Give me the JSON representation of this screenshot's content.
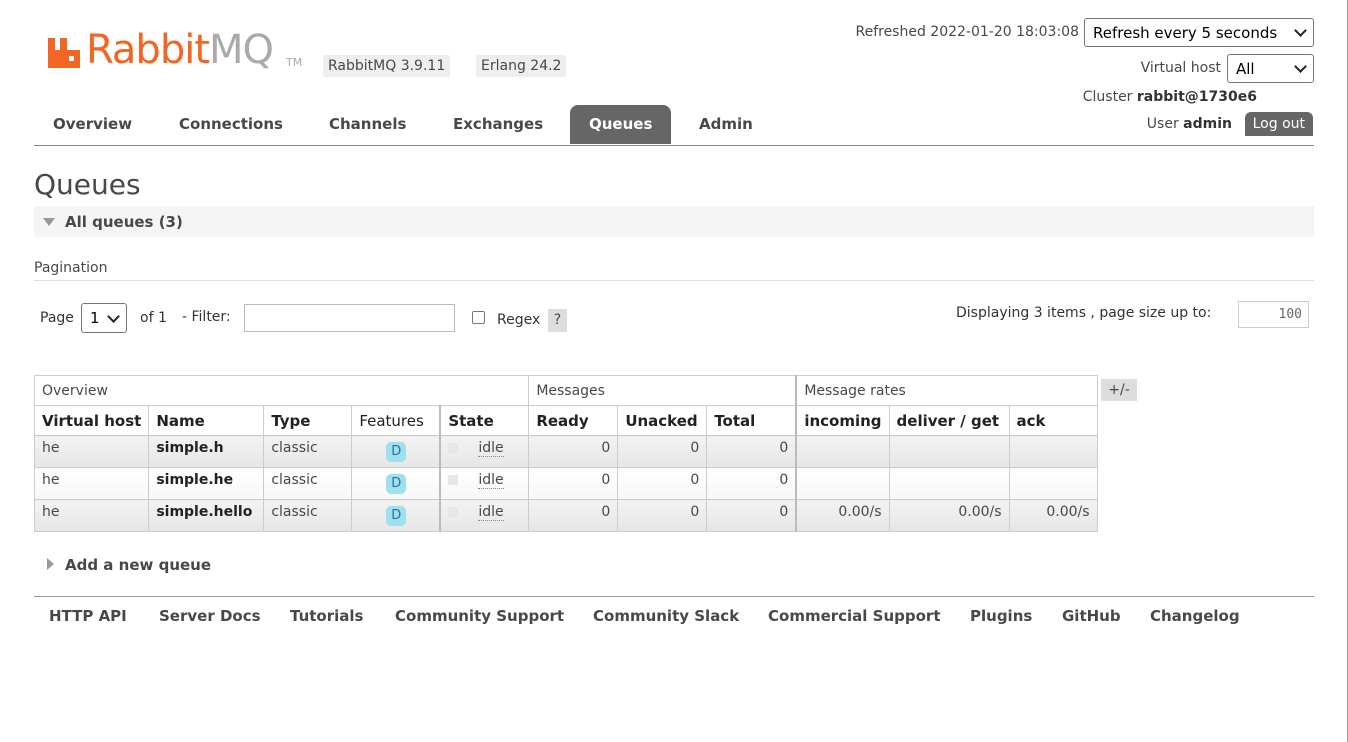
{
  "header": {
    "logo_text_orange": "Rabbit",
    "logo_text_gray": "MQ",
    "logo_tm": "TM",
    "version_rabbitmq": "RabbitMQ 3.9.11",
    "version_erlang": "Erlang 24.2",
    "refreshed_text": "Refreshed 2022-01-20 18:03:08",
    "refresh_select": "Refresh every 5 seconds",
    "vhost_label": "Virtual host",
    "vhost_select": "All",
    "cluster_label": "Cluster",
    "cluster_name": "rabbit@1730e6",
    "user_label": "User",
    "user_name": "admin",
    "logout_label": "Log out"
  },
  "nav": {
    "tabs": [
      "Overview",
      "Connections",
      "Channels",
      "Exchanges",
      "Queues",
      "Admin"
    ],
    "active": "Queues"
  },
  "page": {
    "title": "Queues",
    "section_title": "All queues (3)",
    "pagination_label": "Pagination",
    "page_label": "Page",
    "page_select": "1",
    "of_label": "of 1",
    "filter_label": "- Filter:",
    "filter_value": "",
    "regex_label": "Regex",
    "help_label": "?",
    "displaying_text": "Displaying 3 items , page size up to:",
    "page_size": "100"
  },
  "table": {
    "groups": [
      "Overview",
      "Messages",
      "Message rates"
    ],
    "columns": [
      "Virtual host",
      "Name",
      "Type",
      "Features",
      "State",
      "Ready",
      "Unacked",
      "Total",
      "incoming",
      "deliver / get",
      "ack"
    ],
    "plus_minus": "+/-",
    "rows": [
      {
        "vhost": "he",
        "name": "simple.h",
        "type": "classic",
        "feature": "D",
        "state": "idle",
        "ready": "0",
        "unacked": "0",
        "total": "0",
        "incoming": "",
        "deliver": "",
        "ack": ""
      },
      {
        "vhost": "he",
        "name": "simple.he",
        "type": "classic",
        "feature": "D",
        "state": "idle",
        "ready": "0",
        "unacked": "0",
        "total": "0",
        "incoming": "",
        "deliver": "",
        "ack": ""
      },
      {
        "vhost": "he",
        "name": "simple.hello",
        "type": "classic",
        "feature": "D",
        "state": "idle",
        "ready": "0",
        "unacked": "0",
        "total": "0",
        "incoming": "0.00/s",
        "deliver": "0.00/s",
        "ack": "0.00/s"
      }
    ]
  },
  "add_queue_label": "Add a new queue",
  "footer": {
    "links": [
      "HTTP API",
      "Server Docs",
      "Tutorials",
      "Community Support",
      "Community Slack",
      "Commercial Support",
      "Plugins",
      "GitHub",
      "Changelog"
    ]
  },
  "colors": {
    "brand_orange": "#f26522",
    "active_tab": "#666666",
    "feature_badge": "#9ee0f2"
  }
}
